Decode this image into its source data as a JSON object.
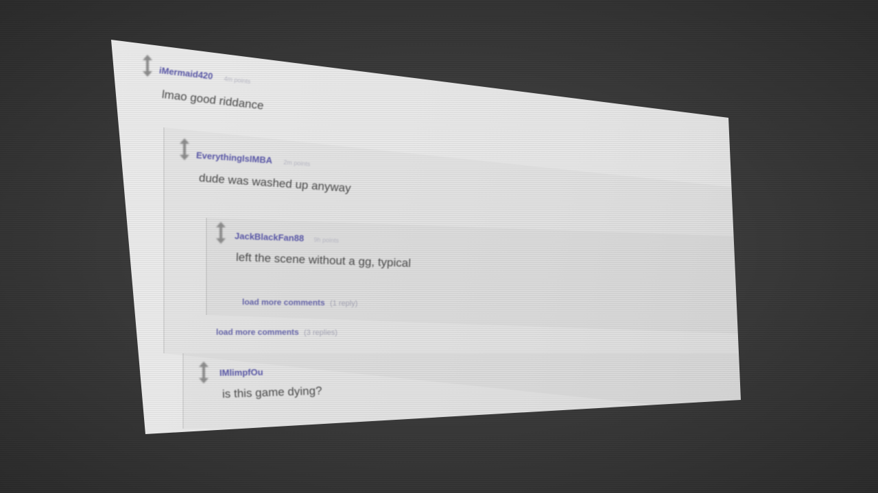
{
  "comments": [
    {
      "user": "iMermaid420",
      "time": "4m points",
      "body": "lmao good riddance"
    },
    {
      "user": "EverythingIsIMBA",
      "time": "2m points",
      "body": "dude was washed up anyway"
    },
    {
      "user": "JackBlackFan88",
      "time": "9h points",
      "body": "left the scene without a gg, typical"
    },
    {
      "user": "IMlimpfOu",
      "time": "",
      "body": "is this game dying?"
    }
  ],
  "load_more": [
    {
      "label": "load more comments",
      "count": "(1 reply)"
    },
    {
      "label": "load more comments",
      "count": "(3 replies)"
    }
  ],
  "icons": {
    "vote": "vote-arrows-icon"
  },
  "colors": {
    "background": "#3b3b3b",
    "sheet": "#e6e6e6",
    "username": "#5a58a8",
    "body_text": "#4a4a4a",
    "link": "#6766ab"
  }
}
